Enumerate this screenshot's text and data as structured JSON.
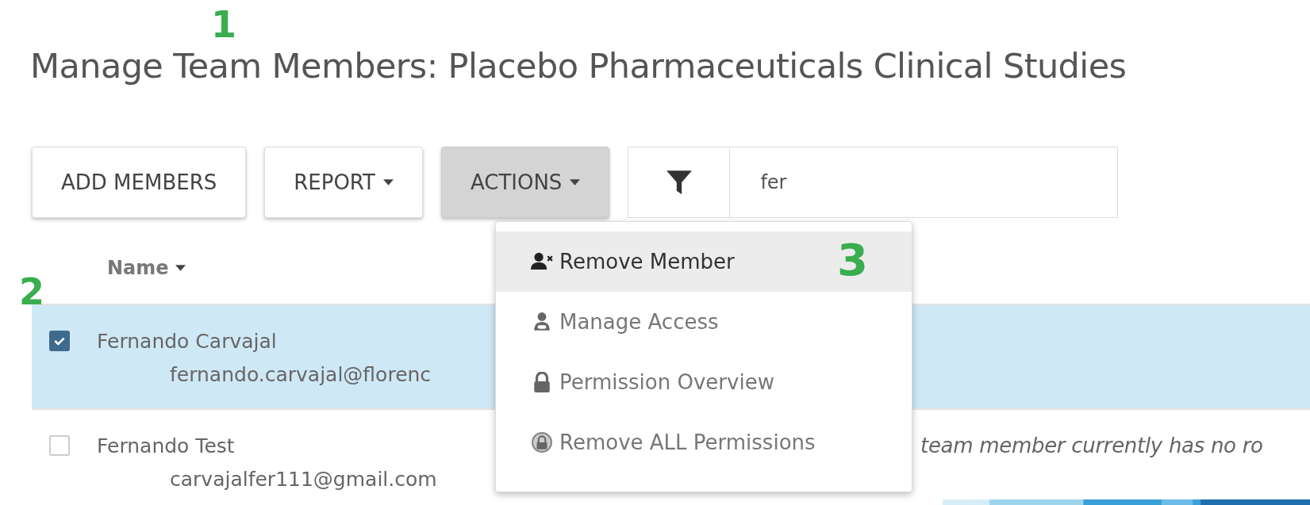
{
  "page_title": "Manage Team Members: Placebo Pharmaceuticals Clinical Studies",
  "toolbar": {
    "buttons": [
      {
        "label": "ADD MEMBERS",
        "dropdown": false,
        "pressed": false
      },
      {
        "label": "REPORT",
        "dropdown": true,
        "pressed": false
      },
      {
        "label": "ACTIONS",
        "dropdown": true,
        "pressed": true
      }
    ],
    "filter": {
      "value": "fer"
    }
  },
  "actions_menu": {
    "items": [
      {
        "label": "Remove Member",
        "selected": true
      },
      {
        "label": "Manage Access",
        "selected": false
      },
      {
        "label": "Permission Overview",
        "selected": false
      },
      {
        "label": "Remove ALL Permissions",
        "selected": false
      }
    ]
  },
  "table": {
    "columns": [
      {
        "label": "Name",
        "sorted": true
      }
    ],
    "rows": [
      {
        "name": "Fernando Carvajal",
        "email": "fernando.carvajal@florenc",
        "checked": true,
        "selected": true
      },
      {
        "name": "Fernando Test",
        "email": "carvajalfer111@gmail.com",
        "checked": false,
        "selected": false,
        "column_2": "team member currently has no ro"
      }
    ]
  },
  "callouts": [
    {
      "label": "1"
    },
    {
      "label": "2"
    },
    {
      "label": "3"
    }
  ]
}
